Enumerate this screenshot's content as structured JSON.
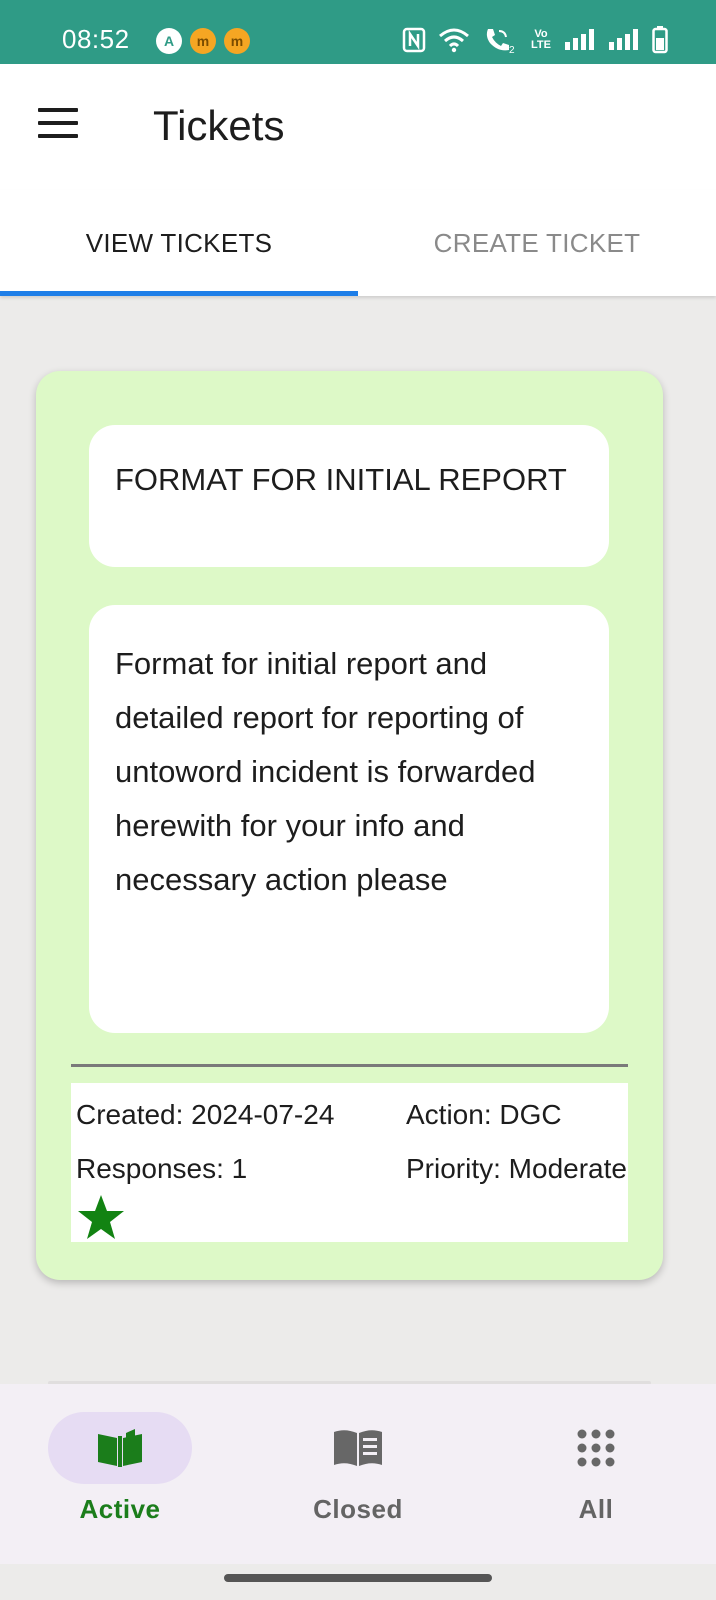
{
  "status_bar": {
    "time": "08:52",
    "left_icons": [
      {
        "icon": "a-circle-icon",
        "glyph": "A"
      },
      {
        "icon": "m-circle-icon",
        "glyph": "m"
      },
      {
        "icon": "m-circle-icon",
        "glyph": "m"
      }
    ],
    "right_icons": [
      "nfc-icon",
      "wifi-icon",
      "wifi-call-icon",
      "volte-icon",
      "signal-icon",
      "signal-icon",
      "battery-icon"
    ],
    "volte_text": "Vo LTE",
    "sim_number": "2"
  },
  "app_bar": {
    "title": "Tickets",
    "menu_icon": "hamburger-menu-icon"
  },
  "tabs": [
    {
      "label": "VIEW TICKETS",
      "active": true
    },
    {
      "label": "CREATE TICKET",
      "active": false
    }
  ],
  "ticket": {
    "subject": "FORMAT FOR INITIAL REPORT",
    "description": "Format for initial report and detailed report for reporting of\nuntoword incident is forwarded herewith for your info and necessary action please",
    "created": "Created: 2024-07-24",
    "action": "Action: DGC",
    "responses": "Responses: 1",
    "priority": "Priority: Moderate",
    "star_icon": "star-icon"
  },
  "bottom_nav": [
    {
      "label": "Active",
      "icon": "open-book-icon",
      "active": true
    },
    {
      "label": "Closed",
      "icon": "closed-book-icon",
      "active": false
    },
    {
      "label": "All",
      "icon": "grid-dots-icon",
      "active": false
    }
  ],
  "colors": {
    "status_bar": "#2f9b86",
    "tab_indicator": "#1e7ee8",
    "card_background": "#ddf9c7",
    "active_nav": "#1b7d1b",
    "nav_pill": "#e6dcf3"
  }
}
